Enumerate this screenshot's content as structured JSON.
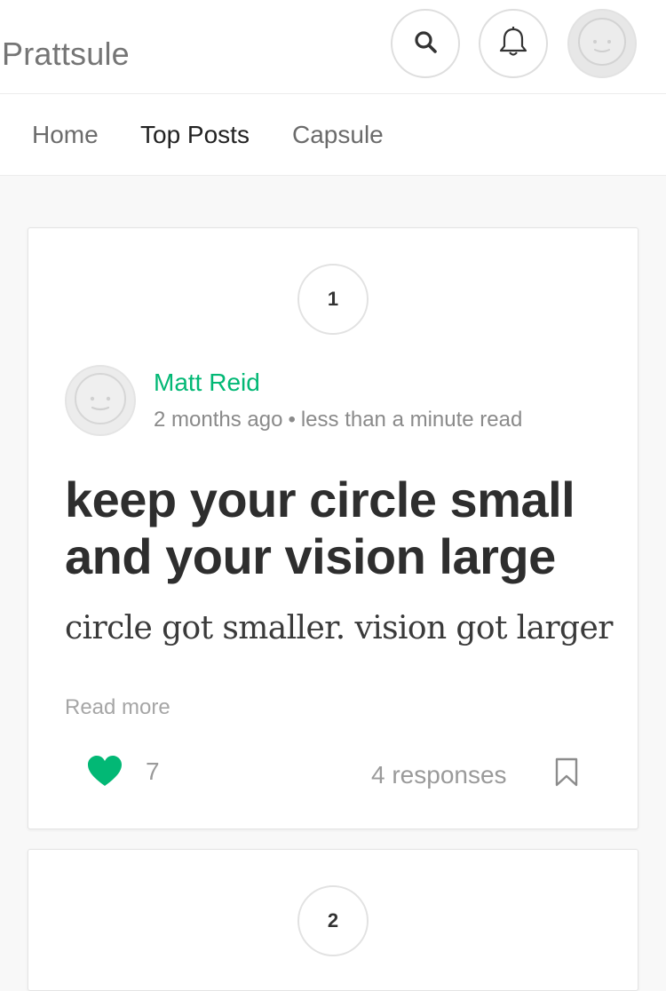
{
  "app": {
    "name": "Prattsule",
    "accent_color": "#02b875"
  },
  "header": {
    "icons": [
      "search-icon",
      "bell-icon",
      "user-avatar-icon"
    ]
  },
  "nav": {
    "items": [
      {
        "label": "Home",
        "active": false
      },
      {
        "label": "Top Posts",
        "active": true
      },
      {
        "label": "Capsule",
        "active": false
      }
    ]
  },
  "posts": [
    {
      "rank": "1",
      "author": "Matt Reid",
      "time": "2 months ago",
      "separator": "•",
      "read_time": "less than a minute read",
      "title": "keep your circle small and your vision large",
      "subtitle": "circle got smaller. vision got larger",
      "read_more": "Read more",
      "likes": "7",
      "liked": true,
      "responses": "4 responses"
    },
    {
      "rank": "2"
    }
  ]
}
